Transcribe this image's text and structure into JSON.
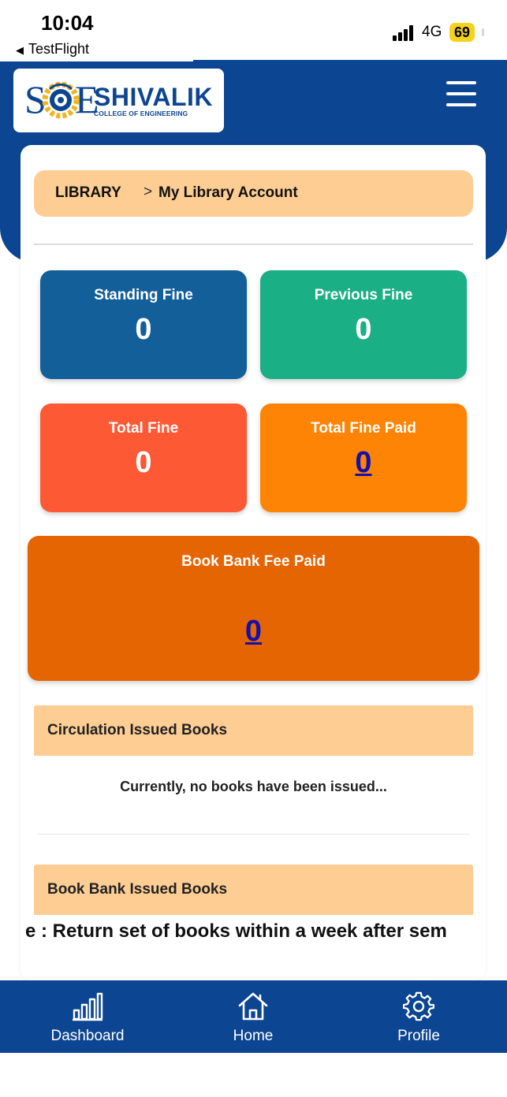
{
  "status_bar": {
    "time": "10:04",
    "back_app": "TestFlight",
    "network": "4G",
    "battery": "69"
  },
  "header": {
    "logo_left_letter": "S",
    "logo_right_letter": "E",
    "logo_name": "SHIVALIK",
    "logo_subtitle": "COLLEGE OF ENGINEERING",
    "menu_icon": "hamburger-menu-icon"
  },
  "breadcrumb": {
    "root": "LIBRARY",
    "separator": ">",
    "current": "My Library Account"
  },
  "fine_tiles": [
    {
      "label": "Standing Fine",
      "value": "0",
      "color": "#135f9a"
    },
    {
      "label": "Previous Fine",
      "value": "0",
      "color": "#1aaf84"
    },
    {
      "label": "Total Fine",
      "value": "0",
      "color": "#fd5934"
    },
    {
      "label": "Total Fine Paid",
      "value": "0",
      "color": "#fd8404"
    }
  ],
  "book_bank_fee": {
    "label": "Book Bank Fee Paid",
    "value": "0",
    "color": "#e56503"
  },
  "sections": {
    "circulation_title": "Circulation Issued Books",
    "circulation_empty": "Currently, no books have been issued...",
    "book_bank_title": "Book Bank Issued Books",
    "notice": "e : Return set of books within a week after sem"
  },
  "bottom_nav": [
    {
      "label": "Dashboard",
      "icon": "bar-chart-icon"
    },
    {
      "label": "Home",
      "icon": "home-icon"
    },
    {
      "label": "Profile",
      "icon": "gear-icon"
    }
  ],
  "colors": {
    "brand_blue": "#0c4591",
    "breadcrumb_bg": "#fdcd94",
    "link_blue": "#1510a8"
  }
}
